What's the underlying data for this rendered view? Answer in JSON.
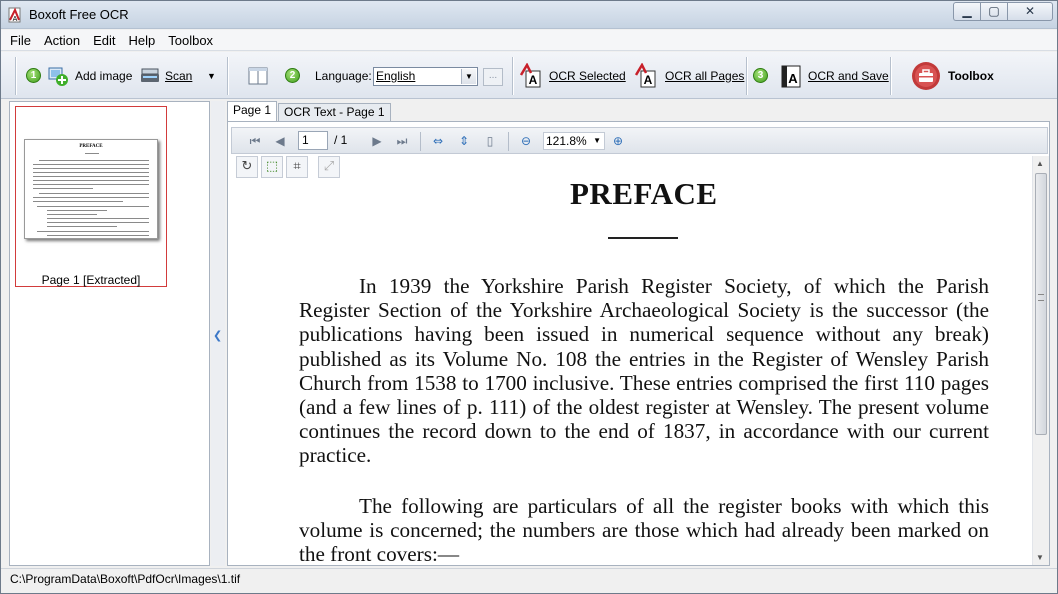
{
  "window": {
    "title": "Boxoft Free OCR",
    "icons": {
      "app": "pdf-ocr-app-icon",
      "minimize": "minimize-icon",
      "maximize": "maximize-icon",
      "close": "close-icon"
    }
  },
  "menu": [
    "File",
    "Action",
    "Edit",
    "Help",
    "Toolbox"
  ],
  "toolbar": {
    "step1": "1",
    "add_image": "Add image",
    "scan": "Scan",
    "step2": "2",
    "language_label": "Language:",
    "language_value": "English",
    "more_button": "...",
    "ocr_selected": "OCR Selected",
    "ocr_all_pages": "OCR all Pages",
    "step3": "3",
    "ocr_and_save": "OCR and Save",
    "toolbox": "Toolbox",
    "colors": {
      "badge": "#3f9d1b",
      "ocr_accent": "#c8202a",
      "toolbox_icon": "#c23a3a"
    }
  },
  "thumbnails": [
    {
      "label": "Page 1 [Extracted]",
      "title": "PREFACE"
    }
  ],
  "tabs": [
    "Page 1",
    "OCR Text - Page 1"
  ],
  "viewer": {
    "page_current": "1",
    "page_total": "/ 1",
    "zoom": "121.8%"
  },
  "document": {
    "title": "PREFACE",
    "paragraph1": "In 1939 the Yorkshire Parish Register Society, of which the Parish Register Section of the Yorkshire Archaeological Society is the successor (the publications having been issued in numerical sequence without any break) published as its Volume No. 108 the entries in the Register of Wensley Parish Church from 1538 to 1700 inclusive. These entries comprised the first 110 pages (and a few lines of p. 111) of the oldest register at Wensley. The present volume continues the record down to the end of 1837, in accordance with our current practice.",
    "paragraph2": "The following are particulars of all the register books with which this volume is concerned; the numbers are those which had already been marked on the front covers:—"
  },
  "status": "C:\\ProgramData\\Boxoft\\PdfOcr\\Images\\1.tif"
}
